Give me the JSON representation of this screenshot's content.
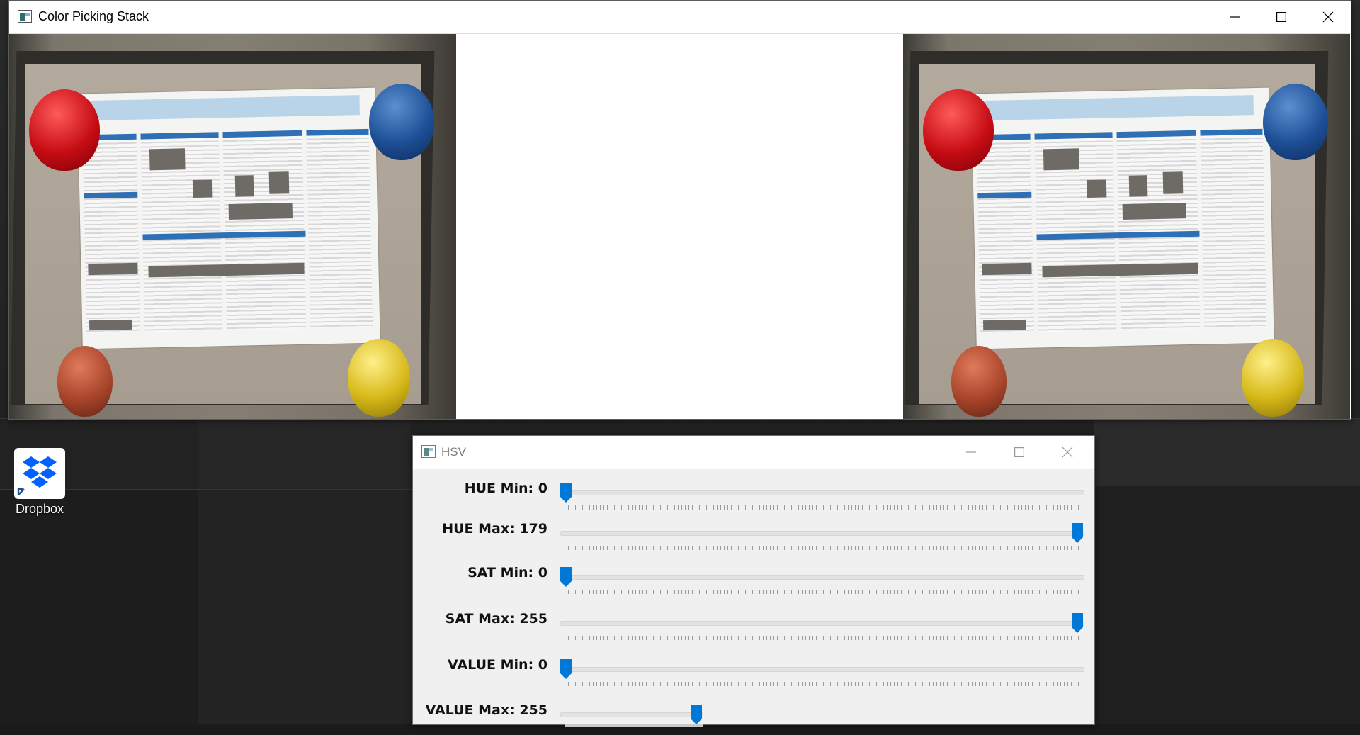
{
  "main_window": {
    "title": "Color Picking Stack",
    "controls": {
      "minimize": "minimize-icon",
      "maximize": "maximize-icon",
      "close": "close-icon"
    }
  },
  "hsv_window": {
    "title": "HSV",
    "sliders": [
      {
        "label": "HUE Min: 0",
        "value": 0,
        "max": 179
      },
      {
        "label": "HUE Max: 179",
        "value": 179,
        "max": 179
      },
      {
        "label": "SAT Min: 0",
        "value": 0,
        "max": 255
      },
      {
        "label": "SAT Max: 255",
        "value": 255,
        "max": 255
      },
      {
        "label": "VALUE Min: 0",
        "value": 0,
        "max": 255
      },
      {
        "label": "VALUE Max: 255",
        "value": 255,
        "max": 255
      }
    ],
    "accent_color": "#0078d7"
  },
  "desktop": {
    "icons": [
      {
        "label": "Dropbox",
        "icon": "dropbox-icon"
      }
    ]
  }
}
